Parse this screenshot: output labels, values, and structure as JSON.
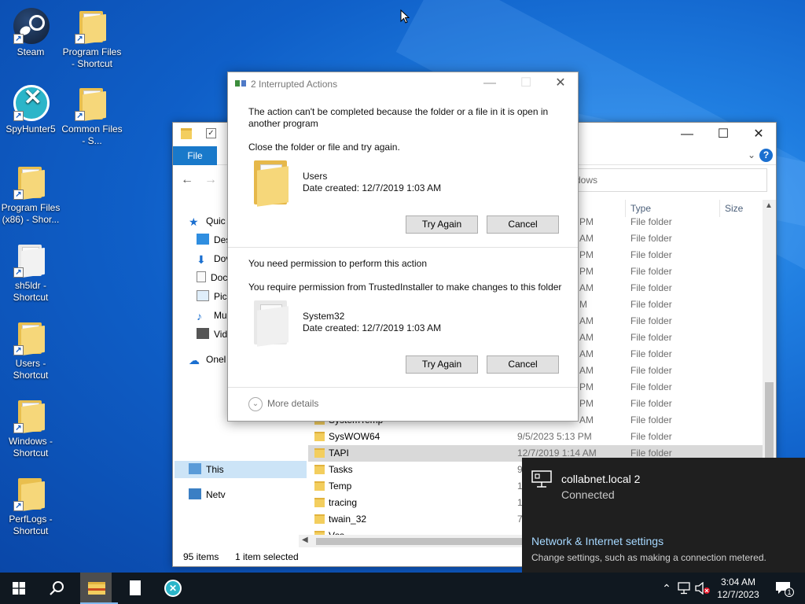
{
  "desktop": {
    "icons": [
      {
        "label": "Steam"
      },
      {
        "label": "Program Files - Shortcut"
      },
      {
        "label": "SpyHunter5"
      },
      {
        "label": "Common Files - S..."
      },
      {
        "label": "Program Files (x86) - Shor..."
      },
      {
        "label": "sh5ldr - Shortcut"
      },
      {
        "label": "Users - Shortcut"
      },
      {
        "label": "Windows - Shortcut"
      },
      {
        "label": "PerfLogs - Shortcut"
      }
    ]
  },
  "explorer": {
    "file_tab": "File",
    "search_text": "dows",
    "nav": [
      "Quic",
      "Des",
      "Dov",
      "Doc",
      "Pic",
      "Mu",
      "Vid",
      "Onel",
      "This",
      "Netv"
    ],
    "columns": {
      "type": "Type",
      "size": "Size"
    },
    "rows_partial": [
      {
        "date": "PM",
        "type": "File folder"
      },
      {
        "date": "AM",
        "type": "File folder"
      },
      {
        "date": "PM",
        "type": "File folder"
      },
      {
        "date": "PM",
        "type": "File folder"
      },
      {
        "date": "AM",
        "type": "File folder"
      },
      {
        "date": "M",
        "type": "File folder"
      },
      {
        "date": "AM",
        "type": "File folder"
      },
      {
        "date": "AM",
        "type": "File folder"
      },
      {
        "date": "AM",
        "type": "File folder"
      },
      {
        "date": "AM",
        "type": "File folder"
      },
      {
        "date": "PM",
        "type": "File folder"
      },
      {
        "date": "PM",
        "type": "File folder"
      },
      {
        "date": "AM",
        "type": "File folder"
      }
    ],
    "rows": [
      {
        "name": "SystemTemp",
        "date": "12/7/2023 2:58 AM",
        "type": "File folder"
      },
      {
        "name": "SysWOW64",
        "date": "9/5/2023 5:13 PM",
        "type": "File folder"
      },
      {
        "name": "TAPI",
        "date": "12/7/2019 1:14 AM",
        "type": "File folder"
      },
      {
        "name": "Tasks",
        "date": "9",
        "type": ""
      },
      {
        "name": "Temp",
        "date": "1",
        "type": ""
      },
      {
        "name": "tracing",
        "date": "1",
        "type": ""
      },
      {
        "name": "twain_32",
        "date": "7",
        "type": ""
      },
      {
        "name": "Vss",
        "date": "",
        "type": ""
      }
    ],
    "status_items": "95 items",
    "status_selected": "1 item selected"
  },
  "dialog": {
    "title": "2 Interrupted Actions",
    "msg1_line1": "The action can't be completed because the folder or a file in it is open in",
    "msg1_line2": "another program",
    "msg1_instruction": "Close the folder or file and try again.",
    "item1_name": "Users",
    "item1_date": "Date created: 12/7/2019 1:03 AM",
    "try_again": "Try Again",
    "cancel": "Cancel",
    "msg2_title": "You need permission to perform this action",
    "msg2_detail": "You require permission from TrustedInstaller to make changes to this folder",
    "item2_name": "System32",
    "item2_date": "Date created: 12/7/2019 1:03 AM",
    "more_details": "More details"
  },
  "network": {
    "name": "collabnet.local 2",
    "status": "Connected",
    "settings_link": "Network & Internet settings",
    "settings_sub": "Change settings, such as making a connection metered."
  },
  "taskbar": {
    "time": "3:04 AM",
    "date": "12/7/2023",
    "notification_count": "1"
  }
}
